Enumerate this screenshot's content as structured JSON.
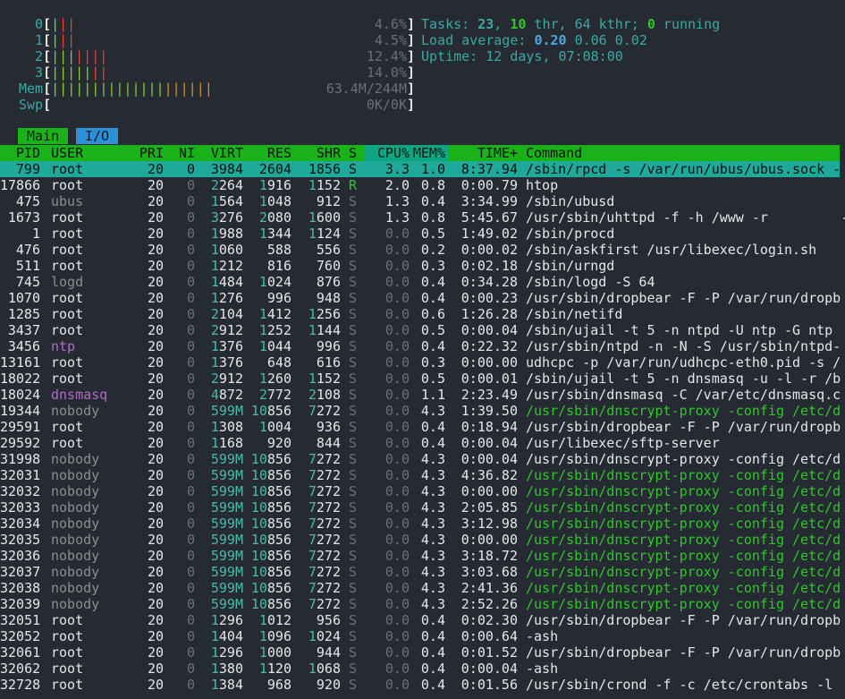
{
  "meters": {
    "cpu": [
      {
        "id": "0",
        "bars": "|||",
        "bar_colors": [
          "green",
          "red",
          "red"
        ],
        "value": "4.6%"
      },
      {
        "id": "1",
        "bars": "|||",
        "bar_colors": [
          "green",
          "red",
          "red"
        ],
        "value": "4.5%"
      },
      {
        "id": "2",
        "bars": "|||||||",
        "bar_colors": [
          "green",
          "green",
          "green",
          "red",
          "red",
          "red",
          "red"
        ],
        "value": "12.4%"
      },
      {
        "id": "3",
        "bars": "|||||||",
        "bar_colors": [
          "green",
          "green",
          "green",
          "green",
          "green",
          "red",
          "red"
        ],
        "value": "14.0%"
      }
    ],
    "mem": {
      "label": "Mem",
      "bars": "||||||||||||||||||||",
      "green_count": 14,
      "value": "63.4M/244M"
    },
    "swp": {
      "label": "Swp",
      "value": "0K/0K"
    }
  },
  "summary": {
    "tasks_label": "Tasks: ",
    "tasks": "23",
    "thr_sep": ", ",
    "thr": "10",
    "thr_label": " thr, ",
    "kthr": "64",
    "kthr_label": " kthr; ",
    "running": "0",
    "running_label": " running",
    "load_label": "Load average: ",
    "load1": "0.20",
    "load5": "0.06",
    "load15": "0.02",
    "uptime_label": "Uptime: ",
    "uptime": "12 days, 07:08:00"
  },
  "tabs": {
    "main": "Main",
    "io": "I/O"
  },
  "columns": {
    "pid": "PID",
    "user": "USER",
    "pri": "PRI",
    "ni": "NI",
    "virt": "VIRT",
    "res": "RES",
    "shr": "SHR",
    "s": "S",
    "cpu": "CPU%",
    "mem": "MEM%",
    "time": "TIME+",
    "command": "Command"
  },
  "processes": [
    {
      "pid": "799",
      "user": "root",
      "pri": "20",
      "ni": "0",
      "virt": "3984",
      "res": "2604",
      "shr": "1856",
      "s": "S",
      "cpu": "3.3",
      "mem": "1.0",
      "time": "8:37.94",
      "cmd": "/sbin/rpcd -s /var/run/ubus/ubus.sock -",
      "selected": true
    },
    {
      "pid": "17866",
      "user": "root",
      "pri": "20",
      "ni": "0",
      "virt": "2264",
      "res": "1916",
      "shr": "1152",
      "s": "R",
      "cpu": "2.0",
      "mem": "0.8",
      "time": "0:00.79",
      "cmd": "htop"
    },
    {
      "pid": "475",
      "user": "ubus",
      "pri": "20",
      "ni": "0",
      "virt": "1564",
      "res": "1048",
      "shr": "912",
      "s": "S",
      "cpu": "1.3",
      "mem": "0.4",
      "time": "3:34.99",
      "cmd": "/sbin/ubusd",
      "ucolor": "g"
    },
    {
      "pid": "1673",
      "user": "root",
      "pri": "20",
      "ni": "0",
      "virt": "3276",
      "res": "2080",
      "shr": "1600",
      "s": "S",
      "cpu": "1.3",
      "mem": "0.8",
      "time": "5:45.67",
      "cmd": "/usr/sbin/uhttpd -f -h /www -r         -"
    },
    {
      "pid": "1",
      "user": "root",
      "pri": "20",
      "ni": "0",
      "virt": "1988",
      "res": "1344",
      "shr": "1124",
      "s": "S",
      "cpu": "0.0",
      "mem": "0.5",
      "time": "1:49.02",
      "cmd": "/sbin/procd"
    },
    {
      "pid": "476",
      "user": "root",
      "pri": "20",
      "ni": "0",
      "virt": "1060",
      "res": "588",
      "shr": "556",
      "s": "S",
      "cpu": "0.0",
      "mem": "0.2",
      "time": "0:00.02",
      "cmd": "/sbin/askfirst /usr/libexec/login.sh"
    },
    {
      "pid": "511",
      "user": "root",
      "pri": "20",
      "ni": "0",
      "virt": "1212",
      "res": "816",
      "shr": "760",
      "s": "S",
      "cpu": "0.0",
      "mem": "0.3",
      "time": "0:02.18",
      "cmd": "/sbin/urngd"
    },
    {
      "pid": "745",
      "user": "logd",
      "pri": "20",
      "ni": "0",
      "virt": "1484",
      "res": "1024",
      "shr": "876",
      "s": "S",
      "cpu": "0.0",
      "mem": "0.4",
      "time": "0:34.28",
      "cmd": "/sbin/logd -S 64",
      "ucolor": "g"
    },
    {
      "pid": "1070",
      "user": "root",
      "pri": "20",
      "ni": "0",
      "virt": "1276",
      "res": "996",
      "shr": "948",
      "s": "S",
      "cpu": "0.0",
      "mem": "0.4",
      "time": "0:00.23",
      "cmd": "/usr/sbin/dropbear -F -P /var/run/dropb"
    },
    {
      "pid": "1285",
      "user": "root",
      "pri": "20",
      "ni": "0",
      "virt": "2104",
      "res": "1412",
      "shr": "1256",
      "s": "S",
      "cpu": "0.0",
      "mem": "0.6",
      "time": "1:26.28",
      "cmd": "/sbin/netifd"
    },
    {
      "pid": "3437",
      "user": "root",
      "pri": "20",
      "ni": "0",
      "virt": "2912",
      "res": "1252",
      "shr": "1144",
      "s": "S",
      "cpu": "0.0",
      "mem": "0.5",
      "time": "0:00.04",
      "cmd": "/sbin/ujail -t 5 -n ntpd -U ntp -G ntp"
    },
    {
      "pid": "3456",
      "user": "ntp",
      "pri": "20",
      "ni": "0",
      "virt": "1376",
      "res": "1044",
      "shr": "996",
      "s": "S",
      "cpu": "0.0",
      "mem": "0.4",
      "time": "0:22.32",
      "cmd": "/usr/sbin/ntpd -n -N -S /usr/sbin/ntpd-",
      "ucolor": "purple"
    },
    {
      "pid": "13161",
      "user": "root",
      "pri": "20",
      "ni": "0",
      "virt": "1376",
      "res": "648",
      "shr": "616",
      "s": "S",
      "cpu": "0.0",
      "mem": "0.3",
      "time": "0:00.00",
      "cmd": "udhcpc -p /var/run/udhcpc-eth0.pid -s /"
    },
    {
      "pid": "18022",
      "user": "root",
      "pri": "20",
      "ni": "0",
      "virt": "2912",
      "res": "1260",
      "shr": "1152",
      "s": "S",
      "cpu": "0.0",
      "mem": "0.5",
      "time": "0:00.01",
      "cmd": "/sbin/ujail -t 5 -n dnsmasq -u -l -r /b"
    },
    {
      "pid": "18024",
      "user": "dnsmasq",
      "pri": "20",
      "ni": "0",
      "virt": "4872",
      "res": "2772",
      "shr": "2108",
      "s": "S",
      "cpu": "0.0",
      "mem": "1.1",
      "time": "2:23.49",
      "cmd": "/usr/sbin/dnsmasq -C /var/etc/dnsmasq.c",
      "ucolor": "purple"
    },
    {
      "pid": "19344",
      "user": "nobody",
      "pri": "20",
      "ni": "0",
      "virt": "599M",
      "res": "10856",
      "shr": "7272",
      "s": "S",
      "cpu": "0.0",
      "mem": "4.3",
      "time": "1:39.50",
      "cmd": "/usr/sbin/dnscrypt-proxy -config /etc/d",
      "ucolor": "g",
      "thread": true
    },
    {
      "pid": "29591",
      "user": "root",
      "pri": "20",
      "ni": "0",
      "virt": "1308",
      "res": "1004",
      "shr": "936",
      "s": "S",
      "cpu": "0.0",
      "mem": "0.4",
      "time": "0:18.94",
      "cmd": "/usr/sbin/dropbear -F -P /var/run/dropb"
    },
    {
      "pid": "29592",
      "user": "root",
      "pri": "20",
      "ni": "0",
      "virt": "1168",
      "res": "920",
      "shr": "844",
      "s": "S",
      "cpu": "0.0",
      "mem": "0.4",
      "time": "0:00.04",
      "cmd": "/usr/libexec/sftp-server"
    },
    {
      "pid": "31998",
      "user": "nobody",
      "pri": "20",
      "ni": "0",
      "virt": "599M",
      "res": "10856",
      "shr": "7272",
      "s": "S",
      "cpu": "0.0",
      "mem": "4.3",
      "time": "0:00.04",
      "cmd": "/usr/sbin/dnscrypt-proxy -config /etc/d",
      "ucolor": "g"
    },
    {
      "pid": "32031",
      "user": "nobody",
      "pri": "20",
      "ni": "0",
      "virt": "599M",
      "res": "10856",
      "shr": "7272",
      "s": "S",
      "cpu": "0.0",
      "mem": "4.3",
      "time": "4:36.82",
      "cmd": "/usr/sbin/dnscrypt-proxy -config /etc/d",
      "ucolor": "g",
      "thread": true
    },
    {
      "pid": "32032",
      "user": "nobody",
      "pri": "20",
      "ni": "0",
      "virt": "599M",
      "res": "10856",
      "shr": "7272",
      "s": "S",
      "cpu": "0.0",
      "mem": "4.3",
      "time": "0:00.00",
      "cmd": "/usr/sbin/dnscrypt-proxy -config /etc/d",
      "ucolor": "g",
      "thread": true
    },
    {
      "pid": "32033",
      "user": "nobody",
      "pri": "20",
      "ni": "0",
      "virt": "599M",
      "res": "10856",
      "shr": "7272",
      "s": "S",
      "cpu": "0.0",
      "mem": "4.3",
      "time": "2:05.85",
      "cmd": "/usr/sbin/dnscrypt-proxy -config /etc/d",
      "ucolor": "g",
      "thread": true
    },
    {
      "pid": "32034",
      "user": "nobody",
      "pri": "20",
      "ni": "0",
      "virt": "599M",
      "res": "10856",
      "shr": "7272",
      "s": "S",
      "cpu": "0.0",
      "mem": "4.3",
      "time": "3:12.98",
      "cmd": "/usr/sbin/dnscrypt-proxy -config /etc/d",
      "ucolor": "g",
      "thread": true
    },
    {
      "pid": "32035",
      "user": "nobody",
      "pri": "20",
      "ni": "0",
      "virt": "599M",
      "res": "10856",
      "shr": "7272",
      "s": "S",
      "cpu": "0.0",
      "mem": "4.3",
      "time": "0:00.00",
      "cmd": "/usr/sbin/dnscrypt-proxy -config /etc/d",
      "ucolor": "g",
      "thread": true
    },
    {
      "pid": "32036",
      "user": "nobody",
      "pri": "20",
      "ni": "0",
      "virt": "599M",
      "res": "10856",
      "shr": "7272",
      "s": "S",
      "cpu": "0.0",
      "mem": "4.3",
      "time": "3:18.72",
      "cmd": "/usr/sbin/dnscrypt-proxy -config /etc/d",
      "ucolor": "g",
      "thread": true
    },
    {
      "pid": "32037",
      "user": "nobody",
      "pri": "20",
      "ni": "0",
      "virt": "599M",
      "res": "10856",
      "shr": "7272",
      "s": "S",
      "cpu": "0.0",
      "mem": "4.3",
      "time": "3:03.68",
      "cmd": "/usr/sbin/dnscrypt-proxy -config /etc/d",
      "ucolor": "g",
      "thread": true
    },
    {
      "pid": "32038",
      "user": "nobody",
      "pri": "20",
      "ni": "0",
      "virt": "599M",
      "res": "10856",
      "shr": "7272",
      "s": "S",
      "cpu": "0.0",
      "mem": "4.3",
      "time": "2:41.36",
      "cmd": "/usr/sbin/dnscrypt-proxy -config /etc/d",
      "ucolor": "g",
      "thread": true
    },
    {
      "pid": "32039",
      "user": "nobody",
      "pri": "20",
      "ni": "0",
      "virt": "599M",
      "res": "10856",
      "shr": "7272",
      "s": "S",
      "cpu": "0.0",
      "mem": "4.3",
      "time": "2:52.26",
      "cmd": "/usr/sbin/dnscrypt-proxy -config /etc/d",
      "ucolor": "g",
      "thread": true
    },
    {
      "pid": "32051",
      "user": "root",
      "pri": "20",
      "ni": "0",
      "virt": "1296",
      "res": "1012",
      "shr": "956",
      "s": "S",
      "cpu": "0.0",
      "mem": "0.4",
      "time": "0:02.30",
      "cmd": "/usr/sbin/dropbear -F -P /var/run/dropb"
    },
    {
      "pid": "32052",
      "user": "root",
      "pri": "20",
      "ni": "0",
      "virt": "1404",
      "res": "1096",
      "shr": "1024",
      "s": "S",
      "cpu": "0.0",
      "mem": "0.4",
      "time": "0:00.64",
      "cmd": "-ash"
    },
    {
      "pid": "32061",
      "user": "root",
      "pri": "20",
      "ni": "0",
      "virt": "1296",
      "res": "1000",
      "shr": "944",
      "s": "S",
      "cpu": "0.0",
      "mem": "0.4",
      "time": "0:01.52",
      "cmd": "/usr/sbin/dropbear -F -P /var/run/dropb"
    },
    {
      "pid": "32062",
      "user": "root",
      "pri": "20",
      "ni": "0",
      "virt": "1380",
      "res": "1120",
      "shr": "1068",
      "s": "S",
      "cpu": "0.0",
      "mem": "0.4",
      "time": "0:00.04",
      "cmd": "-ash"
    },
    {
      "pid": "32728",
      "user": "root",
      "pri": "20",
      "ni": "0",
      "virt": "1384",
      "res": "968",
      "shr": "920",
      "s": "S",
      "cpu": "0.0",
      "mem": "0.4",
      "time": "0:01.56",
      "cmd": "/usr/sbin/crond -f -c /etc/crontabs -l"
    }
  ]
}
